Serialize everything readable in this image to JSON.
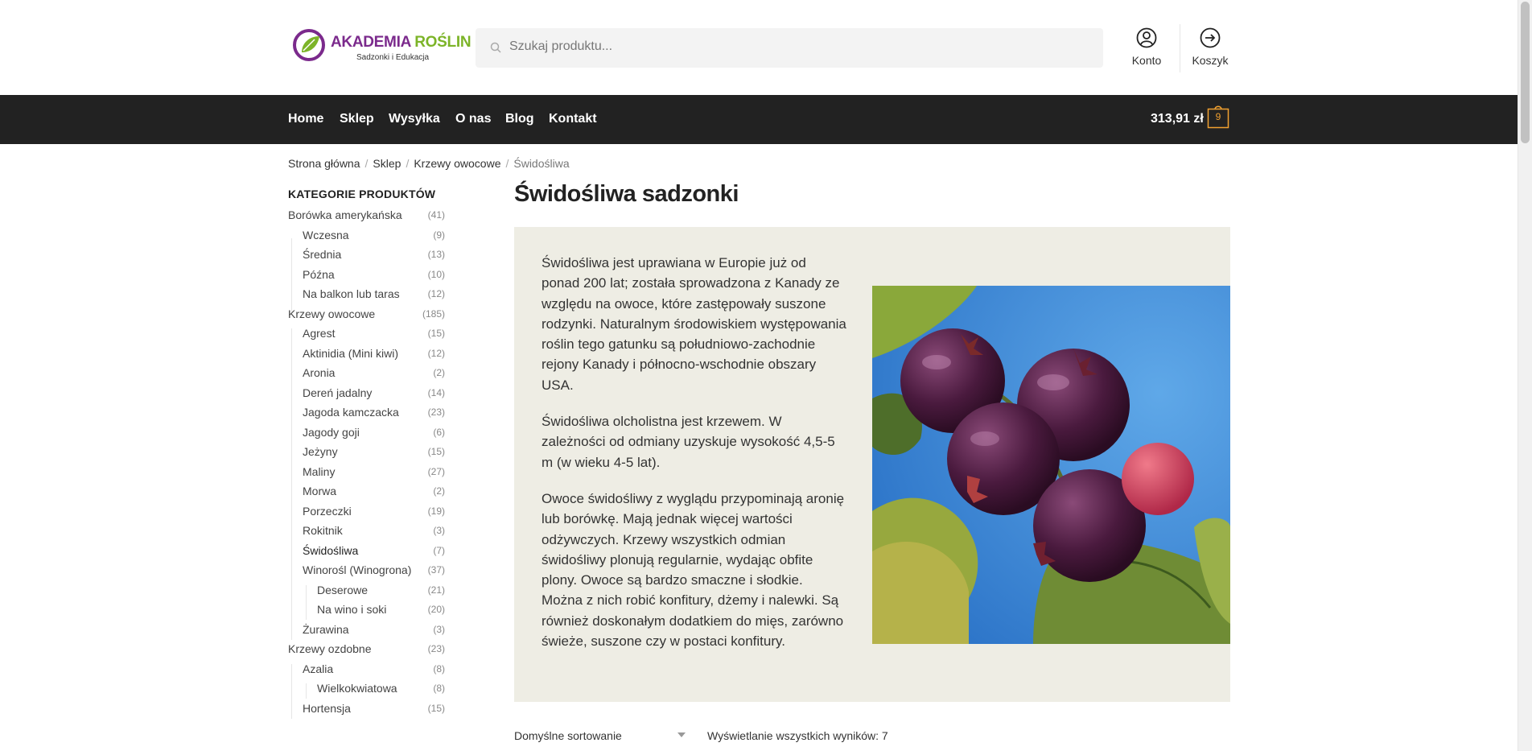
{
  "brand": {
    "name_part1": "AKADEMIA ",
    "name_part2": "ROŚLIN",
    "tagline": "Sadzonki i Edukacja",
    "primary": "#7b2a8c",
    "accent": "#7cb428"
  },
  "search": {
    "placeholder": "Szukaj produktu..."
  },
  "header": {
    "account_label": "Konto",
    "cart_label": "Koszyk"
  },
  "nav": {
    "items": [
      "Home",
      "Sklep",
      "Wysyłka",
      "O nas",
      "Blog",
      "Kontakt"
    ],
    "cart_total": "313,91 zł",
    "cart_count": "9"
  },
  "breadcrumb": [
    "Strona główna",
    "Sklep",
    "Krzewy owocowe",
    "Świdośliwa"
  ],
  "sidebar": {
    "title": "KATEGORIE PRODUKTÓW",
    "categories": [
      {
        "name": "Borówka amerykańska",
        "count": "(41)",
        "level": 0
      },
      {
        "name": "Wczesna",
        "count": "(9)",
        "level": 1
      },
      {
        "name": "Średnia",
        "count": "(13)",
        "level": 1
      },
      {
        "name": "Późna",
        "count": "(10)",
        "level": 1
      },
      {
        "name": "Na balkon lub taras",
        "count": "(12)",
        "level": 1
      },
      {
        "name": "Krzewy owocowe",
        "count": "(185)",
        "level": 0
      },
      {
        "name": "Agrest",
        "count": "(15)",
        "level": 1
      },
      {
        "name": "Aktinidia (Mini kiwi)",
        "count": "(12)",
        "level": 1
      },
      {
        "name": "Aronia",
        "count": "(2)",
        "level": 1
      },
      {
        "name": "Dereń jadalny",
        "count": "(14)",
        "level": 1
      },
      {
        "name": "Jagoda kamczacka",
        "count": "(23)",
        "level": 1
      },
      {
        "name": "Jagody goji",
        "count": "(6)",
        "level": 1
      },
      {
        "name": "Jeżyny",
        "count": "(15)",
        "level": 1
      },
      {
        "name": "Maliny",
        "count": "(27)",
        "level": 1
      },
      {
        "name": "Morwa",
        "count": "(2)",
        "level": 1
      },
      {
        "name": "Porzeczki",
        "count": "(19)",
        "level": 1
      },
      {
        "name": "Rokitnik",
        "count": "(3)",
        "level": 1
      },
      {
        "name": "Świdośliwa",
        "count": "(7)",
        "level": 1,
        "active": true
      },
      {
        "name": "Winorośl (Winogrona)",
        "count": "(37)",
        "level": 1
      },
      {
        "name": "Deserowe",
        "count": "(21)",
        "level": 2
      },
      {
        "name": "Na wino i soki",
        "count": "(20)",
        "level": 2
      },
      {
        "name": "Żurawina",
        "count": "(3)",
        "level": 1
      },
      {
        "name": "Krzewy ozdobne",
        "count": "(23)",
        "level": 0
      },
      {
        "name": "Azalia",
        "count": "(8)",
        "level": 1
      },
      {
        "name": "Wielkokwiatowa",
        "count": "(8)",
        "level": 2
      },
      {
        "name": "Hortensja",
        "count": "(15)",
        "level": 1
      }
    ]
  },
  "page": {
    "title": "Świdośliwa sadzonki",
    "paragraphs": [
      "Świdośliwa jest uprawiana w Europie już od ponad 200 lat; została sprowadzona z Kanady ze względu na owoce, które zastępowały suszone rodzynki. Naturalnym środowiskiem występowania roślin tego gatunku są południowo-zachodnie rejony Kanady i północno-wschodnie obszary USA.",
      "Świdośliwa olcholistna jest krzewem. W zależności od odmiany uzyskuje wysokość 4,5-5 m (w wieku 4-5 lat).",
      "Owoce świdośliwy z wyglądu przypominają aronię lub borówkę. Mają jednak więcej wartości odżywczych. Krzewy wszystkich odmian świdośliwy plonują regularnie, wydając obfite plony. Owoce są bardzo smaczne i słodkie. Można z nich robić konfitury, dżemy i nalewki. Są również doskonałym dodatkiem do mięs, zarówno świeże, suszone czy w postaci konfitury."
    ]
  },
  "toolbar": {
    "sort_label": "Domyślne sortowanie",
    "results": "Wyświetlanie wszystkich wyników: 7"
  }
}
